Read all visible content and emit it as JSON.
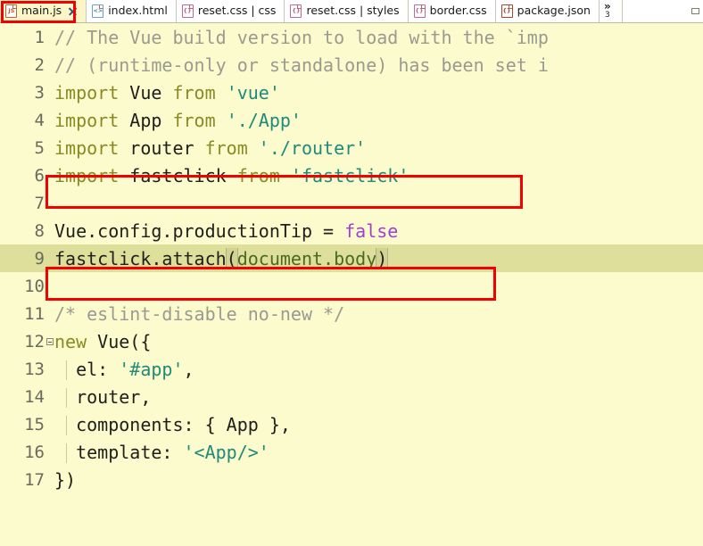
{
  "window": {
    "minimize_icon": "minimize-box"
  },
  "tabbar": {
    "tabs": [
      {
        "label": "main.js",
        "icon": "js-file-icon",
        "icon_text": "JS",
        "active": true,
        "closable": true
      },
      {
        "label": "index.html",
        "icon": "html-file-icon",
        "icon_text": "<>",
        "active": false,
        "closable": false
      },
      {
        "label": "reset.css | css",
        "icon": "css-file-icon",
        "icon_text": "{}",
        "active": false,
        "closable": false
      },
      {
        "label": "reset.css | styles",
        "icon": "css-file-icon",
        "icon_text": "{}",
        "active": false,
        "closable": false
      },
      {
        "label": "border.css",
        "icon": "css-file-icon",
        "icon_text": "{}",
        "active": false,
        "closable": false
      },
      {
        "label": "package.json",
        "icon": "json-file-icon",
        "icon_text": "{}",
        "active": false,
        "closable": false
      }
    ],
    "overflow": {
      "chevron": "»",
      "count": "3"
    }
  },
  "editor": {
    "language": "JavaScript",
    "current_line": 9,
    "lines": [
      {
        "num": "1",
        "text": "// The Vue build version to load with the `imp"
      },
      {
        "num": "2",
        "text": "// (runtime-only or standalone) has been set i"
      },
      {
        "num": "3",
        "text": "import Vue from 'vue'"
      },
      {
        "num": "4",
        "text": "import App from './App'"
      },
      {
        "num": "5",
        "text": "import router from './router'"
      },
      {
        "num": "6",
        "text": "import fastclick from 'fastclick'"
      },
      {
        "num": "7",
        "text": ""
      },
      {
        "num": "8",
        "text": "Vue.config.productionTip = false"
      },
      {
        "num": "9",
        "text": "fastclick.attach(document.body)"
      },
      {
        "num": "10",
        "text": ""
      },
      {
        "num": "11",
        "text": "/* eslint-disable no-new */"
      },
      {
        "num": "12",
        "text": "new Vue({"
      },
      {
        "num": "13",
        "text": "  el: '#app',"
      },
      {
        "num": "14",
        "text": "  router,"
      },
      {
        "num": "15",
        "text": "  components: { App },"
      },
      {
        "num": "16",
        "text": "  template: '<App/>'"
      },
      {
        "num": "17",
        "text": "})"
      }
    ]
  },
  "annotations": {
    "color": "#f40000",
    "boxes": [
      {
        "name": "highlight-tab-mainjs",
        "target": "main.js tab"
      },
      {
        "name": "highlight-import-line",
        "target": "import fastclick from 'fastclick'"
      },
      {
        "name": "highlight-attach-line",
        "target": "fastclick.attach(document.body)"
      }
    ]
  },
  "colors": {
    "editor_background": "#fbfbcd",
    "current_line": "#dedf9a",
    "comment": "#9a9a90",
    "keyword": "#8a8a23",
    "string": "#1f8a7a",
    "constant": "#a23fd0",
    "text": "#20201a",
    "gutter_text": "#6a6a5e",
    "active_tab_background": "#fbf6c8",
    "annotation": "#f40000"
  }
}
